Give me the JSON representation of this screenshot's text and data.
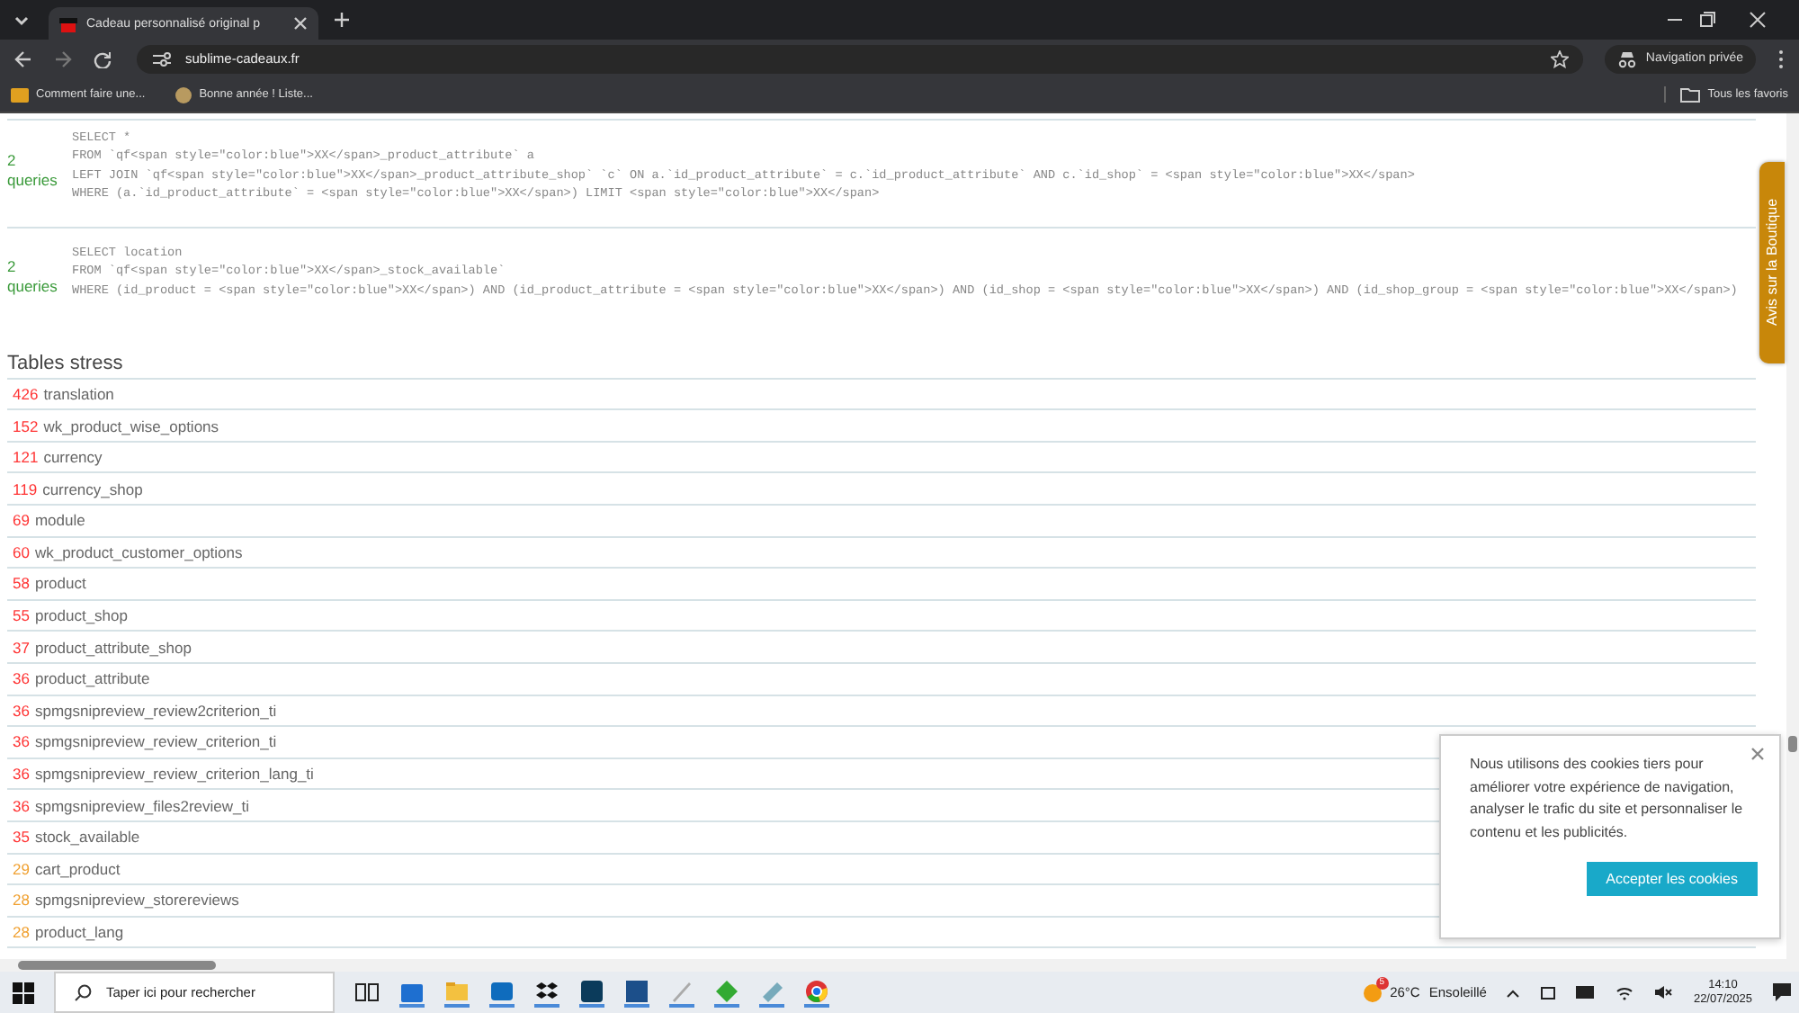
{
  "browser": {
    "tab_title": "Cadeau personnalisé original p",
    "url": "sublime-cadeaux.fr",
    "private_label": "Navigation privée",
    "bookmarks": [
      "Comment faire une...",
      "Bonne année ! Liste..."
    ],
    "all_bookmarks": "Tous les favoris"
  },
  "queries": [
    {
      "count": "2",
      "label": "queries",
      "lines": [
        "SELECT *",
        "FROM `qf<span style=\"color:blue\">XX</span>_product_attribute` a",
        "LEFT JOIN `qf<span style=\"color:blue\">XX</span>_product_attribute_shop` `c` ON a.`id_product_attribute` = c.`id_product_attribute` AND c.`id_shop` = <span style=\"color:blue\">XX</span>",
        "WHERE (a.`id_product_attribute` = <span style=\"color:blue\">XX</span>) LIMIT <span style=\"color:blue\">XX</span>"
      ]
    },
    {
      "count": "2",
      "label": "queries",
      "lines": [
        "SELECT location",
        "FROM `qf<span style=\"color:blue\">XX</span>_stock_available`",
        "WHERE (id_product = <span style=\"color:blue\">XX</span>) AND (id_product_attribute = <span style=\"color:blue\">XX</span>) AND (id_shop = <span style=\"color:blue\">XX</span>) AND (id_shop_group = <span style=\"color:blue\">XX</span>)"
      ]
    }
  ],
  "tables_stress": {
    "title": "Tables stress",
    "rows": [
      {
        "count": "426",
        "name": "translation",
        "color": "#ff3333"
      },
      {
        "count": "152",
        "name": "wk_product_wise_options",
        "color": "#ff3333"
      },
      {
        "count": "121",
        "name": "currency",
        "color": "#ff3333"
      },
      {
        "count": "119",
        "name": "currency_shop",
        "color": "#ff3333"
      },
      {
        "count": "69",
        "name": "module",
        "color": "#ff3333"
      },
      {
        "count": "60",
        "name": "wk_product_customer_options",
        "color": "#ff3333"
      },
      {
        "count": "58",
        "name": "product",
        "color": "#ff3333"
      },
      {
        "count": "55",
        "name": "product_shop",
        "color": "#ff3333"
      },
      {
        "count": "37",
        "name": "product_attribute_shop",
        "color": "#ff3333"
      },
      {
        "count": "36",
        "name": "product_attribute",
        "color": "#ff3333"
      },
      {
        "count": "36",
        "name": "spmgsnipreview_review2criterion_ti",
        "color": "#ff3333"
      },
      {
        "count": "36",
        "name": "spmgsnipreview_review_criterion_ti",
        "color": "#ff3333"
      },
      {
        "count": "36",
        "name": "spmgsnipreview_review_criterion_lang_ti",
        "color": "#ff3333"
      },
      {
        "count": "36",
        "name": "spmgsnipreview_files2review_ti",
        "color": "#ff3333"
      },
      {
        "count": "35",
        "name": "stock_available",
        "color": "#ff3333"
      },
      {
        "count": "29",
        "name": "cart_product",
        "color": "#f0a030"
      },
      {
        "count": "28",
        "name": "spmgsnipreview_storereviews",
        "color": "#f0a030"
      },
      {
        "count": "28",
        "name": "product_lang",
        "color": "#f0a030"
      }
    ]
  },
  "feedback_tab": "Avis sur la Boutique",
  "cookie_banner": {
    "text": "Nous utilisons des cookies tiers pour améliorer votre expérience de navigation, analyser le trafic du site et personnaliser le contenu et les publicités.",
    "button": "Accepter les cookies"
  },
  "taskbar": {
    "search_placeholder": "Taper ici pour rechercher",
    "weather_badge": "5",
    "temperature": "26°C",
    "weather": "Ensoleillé",
    "time": "14:10",
    "date": "22/07/2025"
  }
}
